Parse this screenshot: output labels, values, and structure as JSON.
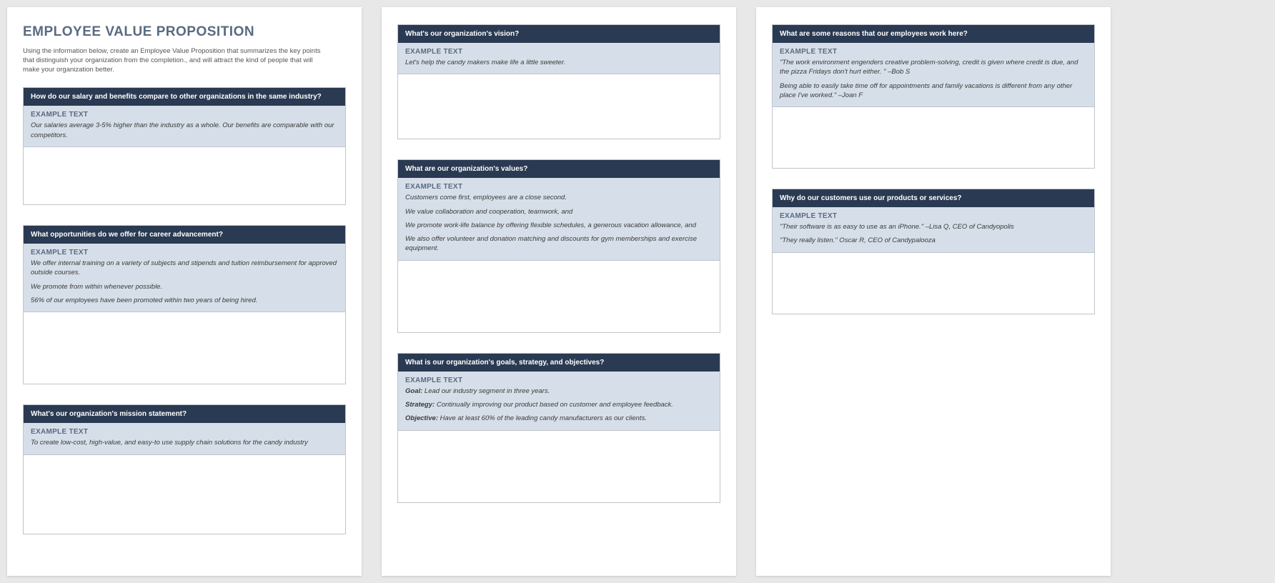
{
  "title": "EMPLOYEE VALUE PROPOSITION",
  "intro": "Using the information below, create an Employee Value Proposition that summarizes the key points that distinguish your organization from the completion., and will attract the kind of people that will make your organization better.",
  "example_label": "EXAMPLE TEXT",
  "sections": {
    "salary": {
      "header": "How do our salary and benefits compare to other organizations in the same industry?",
      "lines": [
        "Our salaries average 3-5% higher than the industry as a whole. Our benefits are comparable with our competitors."
      ]
    },
    "career": {
      "header": "What opportunities do we offer for career advancement?",
      "lines": [
        "We offer internal training on a variety of subjects and stipends and tuition reimbursement for approved outside courses.",
        "We promote from within whenever possible.",
        "56% of our employees have been promoted within two years of being hired."
      ]
    },
    "mission": {
      "header": "What's our organization's mission statement?",
      "lines": [
        "To create low-cost, high-value, and easy-to use supply chain solutions for the candy industry"
      ]
    },
    "vision": {
      "header": "What's our organization's vision?",
      "lines": [
        "Let's help the candy makers make life a little sweeter."
      ]
    },
    "values": {
      "header": "What are our organization's values?",
      "lines": [
        "Customers come first, employees are a close second.",
        "We value collaboration and cooperation, teamwork, and",
        "We promote work-life balance by offering flexible schedules, a generous vacation allowance, and",
        "We also offer volunteer and donation matching and discounts for gym memberships and exercise equipment."
      ]
    },
    "goals": {
      "header": "What is our organization's goals, strategy, and objectives?",
      "goal_label": "Goal:",
      "goal_text": " Lead our industry segment in three years.",
      "strategy_label": "Strategy:",
      "strategy_text": " Continually improving our product based on customer and employee feedback.",
      "objective_label": "Objective:",
      "objective_text": " Have at least 60% of the leading candy manufacturers as our clients."
    },
    "reasons": {
      "header": "What are some reasons that our employees work here?",
      "lines": [
        "\"The work environment engenders creative problem-solving, credit is given where credit is due, and the pizza Fridays don't hurt either. \" –Bob S",
        "Being able to easily take time off for appointments and family vacations is different from any other place I've worked.\" –Joan F"
      ]
    },
    "customers": {
      "header": "Why do our customers use our products or services?",
      "lines": [
        "\"Their software is as easy to use as an iPhone.\" –Lisa Q, CEO of Candyopolis",
        "\"They really listen.\" Oscar R, CEO of Candypalooza"
      ]
    }
  }
}
